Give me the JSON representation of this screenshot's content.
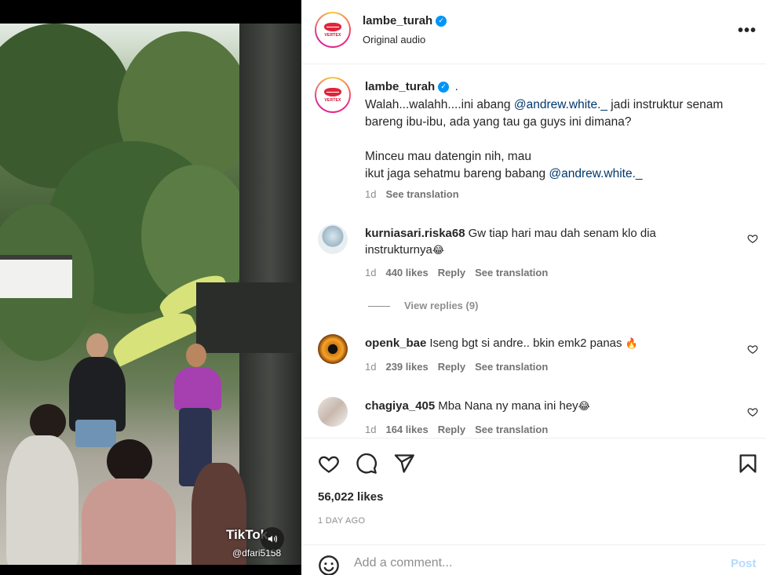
{
  "post": {
    "author": "lambe_turah",
    "audio": "Original audio",
    "caption_dot": ".",
    "caption_line1_pre": "Walah...walahh....ini abang ",
    "caption_mention1": "@andrew.white._",
    "caption_line1_post": " jadi instruktur senam bareng ibu-ibu, ada yang tau ga guys ini dimana?",
    "caption_line2": "Minceu mau datengin nih, mau",
    "caption_line3_pre": "ikut jaga sehatmu bareng babang ",
    "caption_mention2": "@andrew.white._",
    "caption_age": "1d",
    "see_translation": "See translation",
    "brand_text": "VERTEX",
    "likes": "56,022 likes",
    "time_ago": "1 DAY AGO"
  },
  "media": {
    "watermark": "TikTok",
    "watermark_user": "@dfari5158",
    "sound_icon": "speaker-icon"
  },
  "comments": [
    {
      "username": "kurniasari.riska68",
      "text": "Gw tiap hari mau dah senam klo dia instrukturnya",
      "emoji": "😂",
      "age": "1d",
      "likes": "440 likes",
      "reply": "Reply",
      "translate": "See translation",
      "view_replies": "View replies (9)"
    },
    {
      "username": "openk_bae",
      "text": "Iseng bgt si andre.. bkin emk2 panas",
      "emoji": "🔥",
      "age": "1d",
      "likes": "239 likes",
      "reply": "Reply",
      "translate": "See translation"
    },
    {
      "username": "chagiya_405",
      "text": "Mba Nana ny mana ini hey",
      "emoji": "😂",
      "age": "1d",
      "likes": "164 likes",
      "reply": "Reply",
      "translate": "See translation"
    }
  ],
  "composer": {
    "placeholder": "Add a comment...",
    "post_label": "Post"
  },
  "icons": {
    "like": "heart-icon",
    "comment": "comment-icon",
    "share": "send-icon",
    "save": "bookmark-icon",
    "more": "more-options-icon",
    "emoji": "emoji-icon",
    "verified": "verified-badge-icon"
  },
  "colors": {
    "accent": "#0095f6",
    "mention": "#00376b",
    "post_disabled": "#b3dbff",
    "brand_red": "#e0243b"
  }
}
